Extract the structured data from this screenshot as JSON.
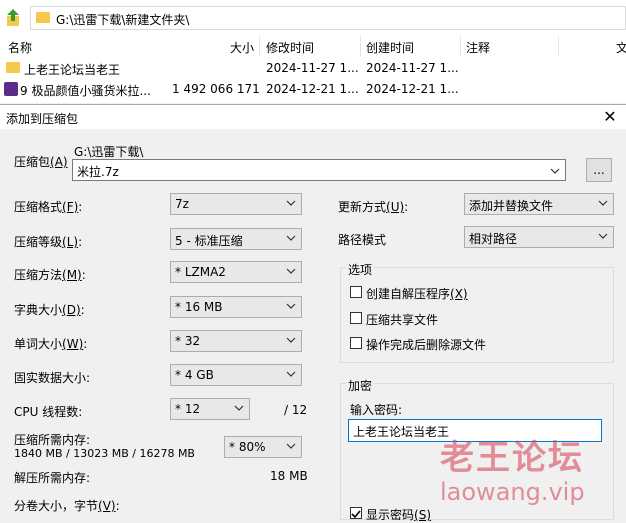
{
  "explorer": {
    "path": "G:\\迅雷下载\\新建文件夹\\",
    "columns": {
      "name": "名称",
      "size": "大小",
      "modified": "修改时间",
      "created": "创建时间",
      "comment": "注释",
      "extra": "文"
    },
    "files": [
      {
        "name": "上老王论坛当老王",
        "size": "",
        "modified": "2024-11-27 1...",
        "created": "2024-11-27 1..."
      },
      {
        "name": "9 极品颜值小骚货米拉...",
        "size": "1 492 066 171",
        "modified": "2024-12-21 1...",
        "created": "2024-12-21 1..."
      }
    ]
  },
  "dialog": {
    "title": "添加到压缩包",
    "close": "✕",
    "archive_label": "压缩包",
    "archive_key": "(A)",
    "archive_dir": "G:\\迅雷下载\\",
    "archive_name": "米拉.7z",
    "browse_label": "...",
    "format": {
      "label": "压缩格式",
      "key": "(F)",
      "value": "7z"
    },
    "level": {
      "label": "压缩等级",
      "key": "(L)",
      "value": "5 - 标准压缩"
    },
    "method": {
      "label": "压缩方法",
      "key": "(M)",
      "value": "* LZMA2"
    },
    "dict": {
      "label": "字典大小",
      "key": "(D)",
      "value": "* 16 MB"
    },
    "word": {
      "label": "单词大小",
      "key": "(W)",
      "value": "* 32"
    },
    "solid": {
      "label": "固实数据大小",
      "key": "",
      "value": "* 4 GB"
    },
    "threads": {
      "label": "CPU 线程数",
      "key": "",
      "value": "* 12",
      "max": "/ 12"
    },
    "memory": {
      "label": "压缩所需内存",
      "key": "",
      "detail": "1840 MB / 13023 MB / 16278 MB",
      "value": "* 80%"
    },
    "decomp": {
      "label": "解压所需内存",
      "key": "",
      "value": "18 MB"
    },
    "split": {
      "label": "分卷大小，字节",
      "key": "(V)"
    },
    "update": {
      "label": "更新方式",
      "key": "(U)",
      "value": "添加并替换文件"
    },
    "pathmode": {
      "label": "路径模式",
      "value": "相对路径"
    },
    "options": {
      "title": "选项",
      "items": [
        {
          "label": "创建自解压程序",
          "key": "(X)",
          "checked": false
        },
        {
          "label": "压缩共享文件",
          "key": "",
          "checked": false
        },
        {
          "label": "操作完成后删除源文件",
          "key": "",
          "checked": false
        }
      ]
    },
    "encryption": {
      "title": "加密",
      "pwd_label": "输入密码",
      "pwd_value": "上老王论坛当老王",
      "show_label": "显示密码",
      "show_key": "(S)",
      "show_checked": true
    }
  },
  "watermark": {
    "line1": "老王论坛",
    "line2": "laowang.vip",
    "color": "#d63c50"
  }
}
